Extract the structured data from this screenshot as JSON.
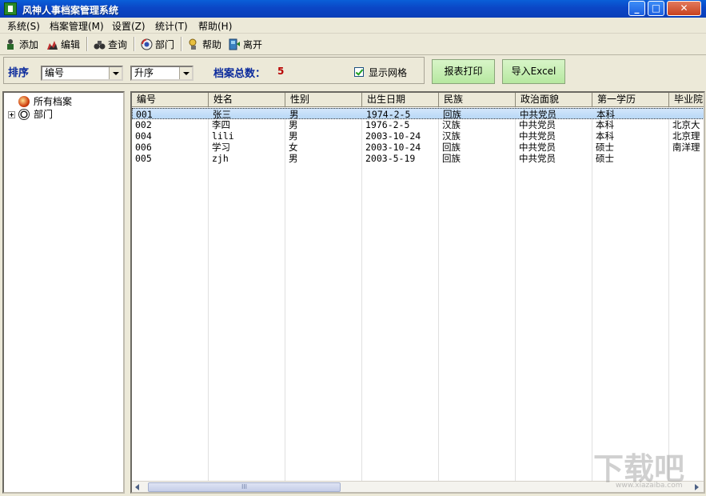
{
  "window": {
    "title": "风神人事档案管理系统",
    "min_symbol": "_",
    "max_symbol": "□",
    "close_symbol": "✕"
  },
  "menu": [
    "系统(S)",
    "档案管理(M)",
    "设置(Z)",
    "统计(T)",
    "帮助(H)"
  ],
  "toolbar": {
    "add": "添加",
    "edit": "编辑",
    "query": "查询",
    "dept": "部门",
    "help": "帮助",
    "exit": "离开"
  },
  "sort": {
    "label": "排序",
    "field_value": "编号",
    "order_value": "升序",
    "total_label": "档案总数：",
    "total_value": "5",
    "show_grid_label": "显示网格",
    "show_grid_checked": true,
    "print_button": "报表打印",
    "excel_button": "导入Excel"
  },
  "tree": {
    "root": "所有档案",
    "child": "部门"
  },
  "table": {
    "headers": [
      "编号",
      "姓名",
      "性别",
      "出生日期",
      "民族",
      "政治面貌",
      "第一学历",
      "毕业院"
    ],
    "rows": [
      [
        "001",
        "张三",
        "男",
        "1974-2-5",
        "回族",
        "中共党员",
        "本科",
        ""
      ],
      [
        "002",
        "李四",
        "男",
        "1976-2-5",
        "汉族",
        "中共党员",
        "本科",
        "北京大"
      ],
      [
        "004",
        "lili",
        "男",
        "2003-10-24",
        "汉族",
        "中共党员",
        "本科",
        "北京理"
      ],
      [
        "006",
        "学习",
        "女",
        "2003-10-24",
        "回族",
        "中共党员",
        "硕士",
        "南洋理"
      ],
      [
        "005",
        "zjh",
        "男",
        "2003-5-19",
        "回族",
        "中共党员",
        "硕士",
        ""
      ]
    ],
    "selected_row": 0
  },
  "scrollbar_grip": "III",
  "watermark": {
    "main": "下载吧",
    "sub": "www.xiazaiba.com"
  },
  "colors": {
    "title_bar": "#0b46c6",
    "label_blue": "#0b2a9c",
    "total_red": "#b80000",
    "button_green": "#b6e8a0"
  }
}
